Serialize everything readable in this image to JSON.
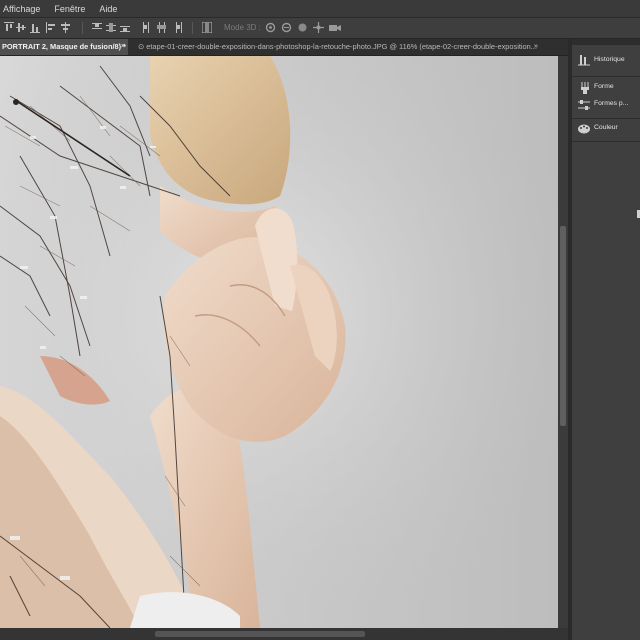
{
  "menu": {
    "items": [
      "Affichage",
      "Fenêtre",
      "Aide"
    ]
  },
  "options_bar": {
    "mode_3d_label": "Mode 3D :"
  },
  "tabs": {
    "active": {
      "label": "PORTRAIT 2, Masque de fusion/8) *",
      "close": "×"
    },
    "inactive": {
      "label": "⊙ etape-01-creer-double-exposition-dans-photoshop-la-retouche-photo.JPG @ 116% (etape-02-creer-double-exposition..."
    },
    "more": "»"
  },
  "panels": {
    "collapse": "«",
    "items": [
      {
        "icon": "history-icon",
        "label": "Historique"
      },
      {
        "icon": "brush-icon",
        "label": "Forme"
      },
      {
        "icon": "brush-presets-icon",
        "label": "Formes p..."
      },
      {
        "icon": "color-palette-icon",
        "label": "Couleur"
      }
    ]
  },
  "canvas": {
    "image": "double exposure portrait of woman covering face with hands, blended with snowy tree branches"
  },
  "colors": {
    "ui_dark": "#3c3c3c",
    "tab_active": "#505050",
    "canvas_bg": "#c9c9c9",
    "skin": "#e7c9b2"
  }
}
